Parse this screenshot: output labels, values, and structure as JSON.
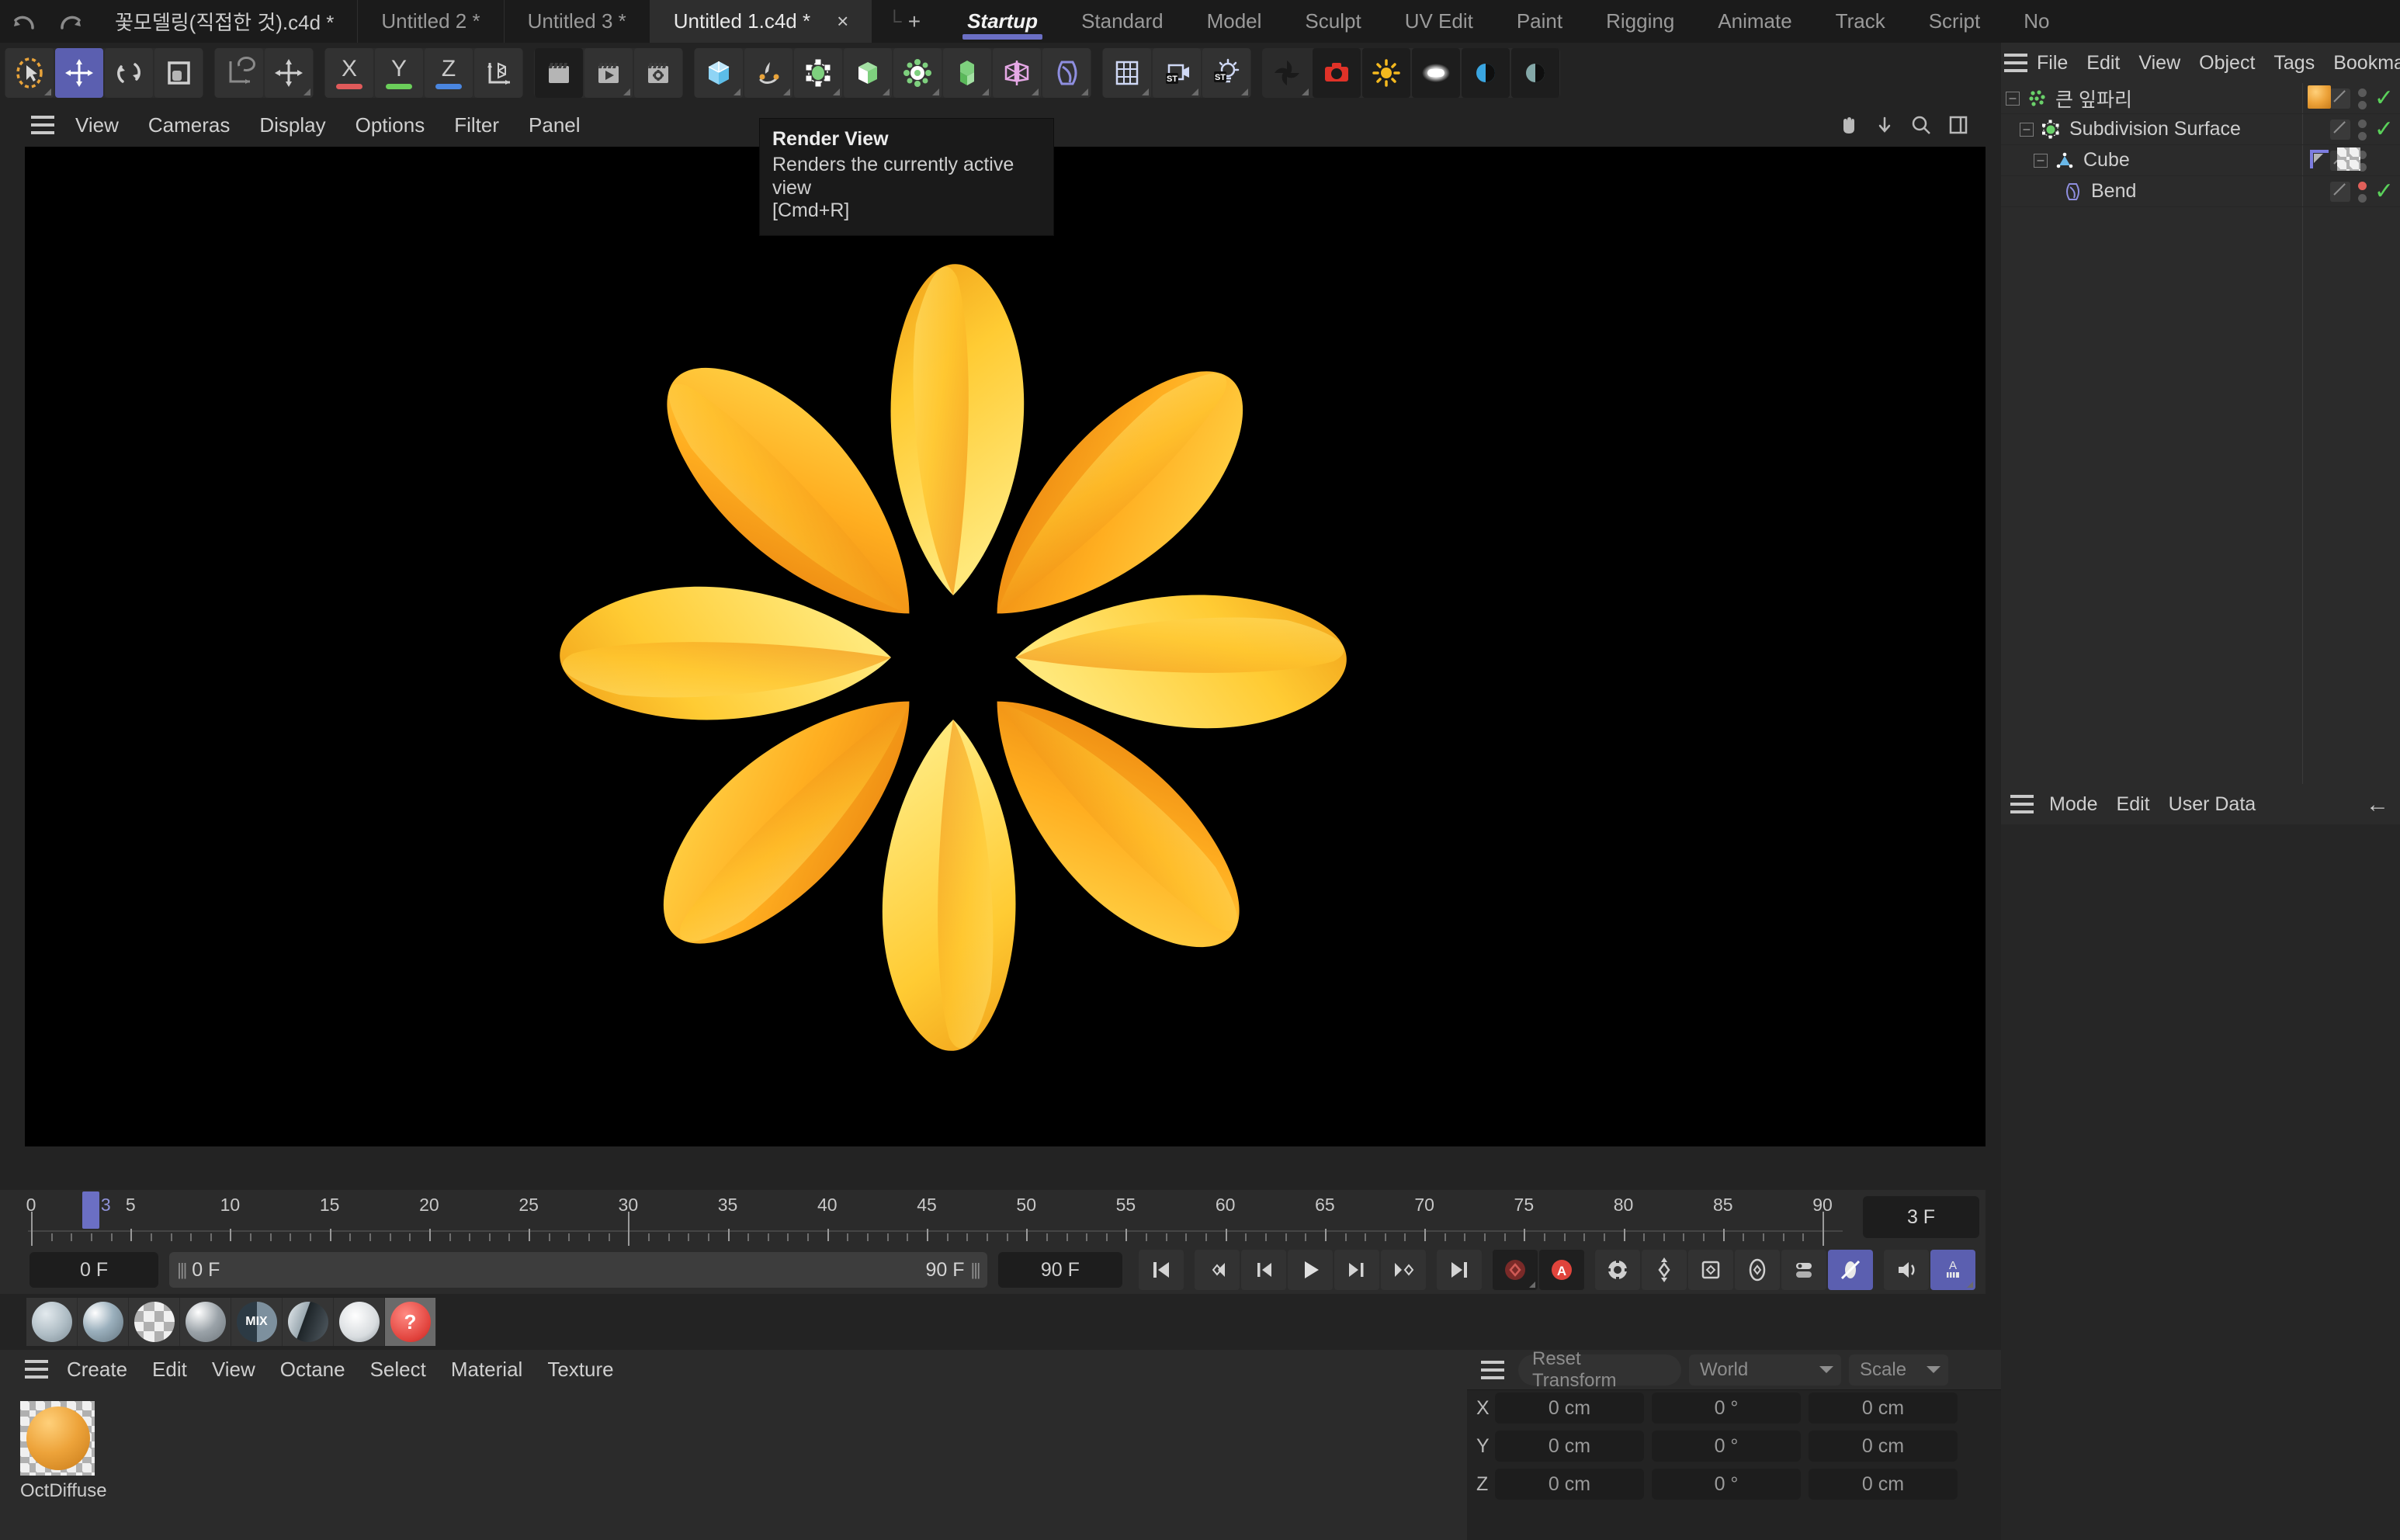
{
  "doc_tabs": [
    {
      "label": "꽃모델링(직접한 것).c4d *",
      "active": false
    },
    {
      "label": "Untitled 2 *",
      "active": false
    },
    {
      "label": "Untitled 3 *",
      "active": false
    },
    {
      "label": "Untitled 1.c4d *",
      "active": true
    }
  ],
  "doc_tab_close": "×",
  "new_tab": {
    "glyph": "└",
    "plus": "+"
  },
  "layout_tabs": [
    {
      "label": "Startup",
      "active": true
    },
    {
      "label": "Standard",
      "active": false
    },
    {
      "label": "Model",
      "active": false
    },
    {
      "label": "Sculpt",
      "active": false
    },
    {
      "label": "UV Edit",
      "active": false
    },
    {
      "label": "Paint",
      "active": false
    },
    {
      "label": "Rigging",
      "active": false
    },
    {
      "label": "Animate",
      "active": false
    },
    {
      "label": "Track",
      "active": false
    },
    {
      "label": "Script",
      "active": false
    },
    {
      "label": "No",
      "active": false
    }
  ],
  "toolbar": {
    "undo_icon": "undo-icon",
    "redo_icon": "redo-icon",
    "live_selection_icon": "live-selection-icon",
    "move_icon": "move-tool-icon",
    "rotate_icon": "rotate-tool-icon",
    "scale_icon": "scale-tool-icon",
    "world_axis_icon": "world-axis-icon",
    "axis_move_icon": "axis-move-icon",
    "x_axis_label": "X",
    "y_axis_label": "Y",
    "z_axis_label": "Z",
    "x_color": "#e05a5a",
    "y_color": "#6bcf5a",
    "z_color": "#4a86e0",
    "coordinate_system_icon": "coordinate-system-icon",
    "render_view_icon": "render-view-icon",
    "render_to_picture_viewer_icon": "render-to-picture-viewer-icon",
    "render_settings_icon": "render-settings-icon",
    "cube_primitive_icon": "cube-primitive-icon",
    "spline_pen_icon": "spline-pen-icon",
    "nurbs_icon": "nurbs-generator-icon",
    "array_icon": "array-object-icon",
    "mograph_icon": "mograph-cloner-icon",
    "deformer_icon": "deformer-icon",
    "symmetry_icon": "symmetry-icon",
    "field_icon": "field-icon",
    "scene_icon": "scene-object-icon",
    "camera_icon": "camera-object-icon",
    "light_icon": "light-object-icon",
    "octane_shutter_icon": "octane-shutter-icon",
    "octane_render_icon": "octane-live-render-icon",
    "octane_sun_icon": "octane-sunlight-icon",
    "octane_area_light_icon": "octane-area-light-icon",
    "octane_daylight_icon": "octane-daylight-icon",
    "octane_hdri_icon": "octane-hdri-environment-icon"
  },
  "viewport": {
    "menu_items": [
      "View",
      "Cameras",
      "Display",
      "Options",
      "Filter",
      "Panel"
    ],
    "burger_icon": "hamburger-menu-icon",
    "right_icons": [
      "pan-hand-icon",
      "move-down-icon",
      "zoom-icon",
      "maximize-viewport-icon"
    ],
    "background_color": "#000000",
    "petal_count": 8,
    "petal_color_light": "#ffd94a",
    "petal_color_dark": "#f08c18"
  },
  "tooltip": {
    "title": "Render View",
    "body": "Renders the currently active view",
    "shortcut": "[Cmd+R]"
  },
  "timeline": {
    "labels": [
      0,
      5,
      10,
      15,
      20,
      25,
      30,
      35,
      40,
      45,
      50,
      55,
      60,
      65,
      70,
      75,
      80,
      85,
      90
    ],
    "min_frame": 0,
    "max_frame": 90,
    "playhead_frame": 3,
    "playhead_label": "3",
    "frame_readout": "3 F"
  },
  "playback": {
    "current_frame_field": "0 F",
    "range_start": "0 F",
    "range_end": "90 F",
    "preview_end_field": "90 F",
    "buttons": [
      {
        "name": "go-to-start-button",
        "icon": "go-to-start-icon"
      },
      {
        "name": "previous-key-button",
        "icon": "previous-key-icon"
      },
      {
        "name": "previous-frame-button",
        "icon": "previous-frame-icon"
      },
      {
        "name": "play-button",
        "icon": "play-icon"
      },
      {
        "name": "next-frame-button",
        "icon": "next-frame-icon"
      },
      {
        "name": "next-key-button",
        "icon": "next-key-icon"
      },
      {
        "name": "go-to-end-button",
        "icon": "go-to-end-icon"
      },
      {
        "name": "record-active-objects-button",
        "icon": "record-keyframe-icon"
      },
      {
        "name": "autokeying-button",
        "icon": "autokey-a-icon"
      },
      {
        "name": "keyframe-settings-button",
        "icon": "keyframe-gear-icon"
      },
      {
        "name": "position-key-button",
        "icon": "position-key-icon"
      },
      {
        "name": "scale-key-button",
        "icon": "scale-key-icon"
      },
      {
        "name": "rotation-key-button",
        "icon": "rotation-key-icon"
      },
      {
        "name": "param-key-button",
        "icon": "parameter-key-icon"
      },
      {
        "name": "pla-key-button",
        "icon": "point-level-animation-icon"
      },
      {
        "name": "sound-button",
        "icon": "sound-icon"
      },
      {
        "name": "animation-layer-button",
        "icon": "animation-layer-icon"
      }
    ]
  },
  "material_swatches": [
    "material-default-grey",
    "material-glossy-blue",
    "material-checker",
    "material-bumpy",
    "material-mix",
    "material-split",
    "material-layered",
    "material-missing"
  ],
  "material_manager": {
    "menu_items": [
      "Create",
      "Edit",
      "View",
      "Octane",
      "Select",
      "Material",
      "Texture"
    ],
    "burger_icon": "hamburger-menu-icon",
    "materials": [
      {
        "name": "OctDiffuse",
        "color": "#eda33a"
      }
    ]
  },
  "coordinates": {
    "reset_label": "Reset Transform",
    "space_label": "World",
    "mode_label": "Scale",
    "burger_icon": "hamburger-menu-icon",
    "rows": [
      {
        "axis": "X",
        "position": "0 cm",
        "rotation": "0 °",
        "size": "0 cm"
      },
      {
        "axis": "Y",
        "position": "0 cm",
        "rotation": "0 °",
        "size": "0 cm"
      },
      {
        "axis": "Z",
        "position": "0 cm",
        "rotation": "0 °",
        "size": "0 cm"
      }
    ]
  },
  "object_manager": {
    "menu_items": [
      "File",
      "Edit",
      "View",
      "Object",
      "Tags",
      "Bookma"
    ],
    "burger_icon": "hamburger-menu-icon",
    "rows": [
      {
        "name": "큰 잎파리",
        "indent": 0,
        "icon": "null-object-icon",
        "expander": "-",
        "enabled": true,
        "dot_red": false,
        "has_material_tag": true,
        "has_other_tags": false
      },
      {
        "name": "Subdivision Surface",
        "indent": 1,
        "icon": "subdivision-surface-icon",
        "expander": "-",
        "enabled": true,
        "dot_red": false,
        "has_material_tag": false,
        "has_other_tags": false
      },
      {
        "name": "Cube",
        "indent": 2,
        "icon": "polygon-object-icon",
        "expander": "-",
        "enabled": false,
        "dot_red": false,
        "has_material_tag": false,
        "has_other_tags": true
      },
      {
        "name": "Bend",
        "indent": 3,
        "icon": "bend-deformer-icon",
        "expander": "",
        "enabled": true,
        "dot_red": true,
        "has_material_tag": false,
        "has_other_tags": false
      }
    ]
  },
  "attribute_manager": {
    "menu_items": [
      "Mode",
      "Edit",
      "User Data"
    ],
    "burger_icon": "hamburger-menu-icon",
    "back_icon": "back-arrow-icon"
  },
  "colors": {
    "accent": "#6b6fc4",
    "panel_bg": "#2b2b2b",
    "window_bg": "#232323",
    "text": "#cfcfcf"
  }
}
